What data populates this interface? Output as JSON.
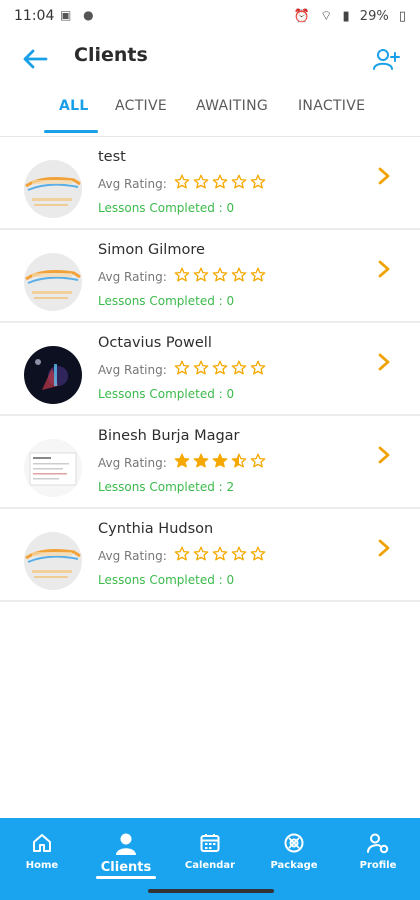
{
  "status_bar": {
    "time": "11:04",
    "battery": "29%"
  },
  "header": {
    "title": "Clients",
    "back_icon": "arrow-left-icon",
    "add_icon": "add-user-icon"
  },
  "tabs": [
    {
      "label": "ALL",
      "active": true
    },
    {
      "label": "ACTIVE",
      "active": false
    },
    {
      "label": "AWAITING",
      "active": false
    },
    {
      "label": "INACTIVE",
      "active": false
    }
  ],
  "clients": [
    {
      "name": "test",
      "rating_label": "Avg Rating:",
      "rating": 0,
      "lessons": "Lessons Completed : 0",
      "avatar": "driving-logo"
    },
    {
      "name": "Simon Gilmore",
      "rating_label": "Avg Rating:",
      "rating": 0,
      "lessons": "Lessons Completed : 0",
      "avatar": "driving-logo"
    },
    {
      "name": "Octavius Powell",
      "rating_label": "Avg Rating:",
      "rating": 0,
      "lessons": "Lessons Completed : 0",
      "avatar": "photo-dark"
    },
    {
      "name": "Binesh Burja Magar",
      "rating_label": "Avg Rating:",
      "rating": 3.5,
      "lessons": "Lessons Completed : 2",
      "avatar": "document-photo"
    },
    {
      "name": "Cynthia Hudson",
      "rating_label": "Avg Rating:",
      "rating": 0,
      "lessons": "Lessons Completed : 0",
      "avatar": "driving-logo"
    }
  ],
  "bottom_nav": [
    {
      "label": "Home",
      "icon": "home-icon",
      "active": false
    },
    {
      "label": "Clients",
      "icon": "user-icon",
      "active": true
    },
    {
      "label": "Calendar",
      "icon": "calendar-icon",
      "active": false
    },
    {
      "label": "Package",
      "icon": "package-icon",
      "active": false
    },
    {
      "label": "Profile",
      "icon": "profile-settings-icon",
      "active": false
    }
  ],
  "colors": {
    "accent": "#1aa0e8",
    "nav_bg": "#1aa3ee",
    "star": "#f5a800",
    "lessons_text": "#3cba4b",
    "chevron": "#f0a200"
  }
}
